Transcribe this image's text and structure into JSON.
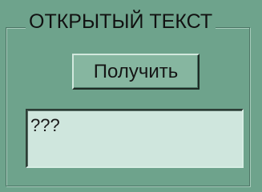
{
  "group": {
    "title": "ОТКРЫТЫЙ ТЕКСТ"
  },
  "button": {
    "label": "Получить"
  },
  "output": {
    "value": "???"
  }
}
